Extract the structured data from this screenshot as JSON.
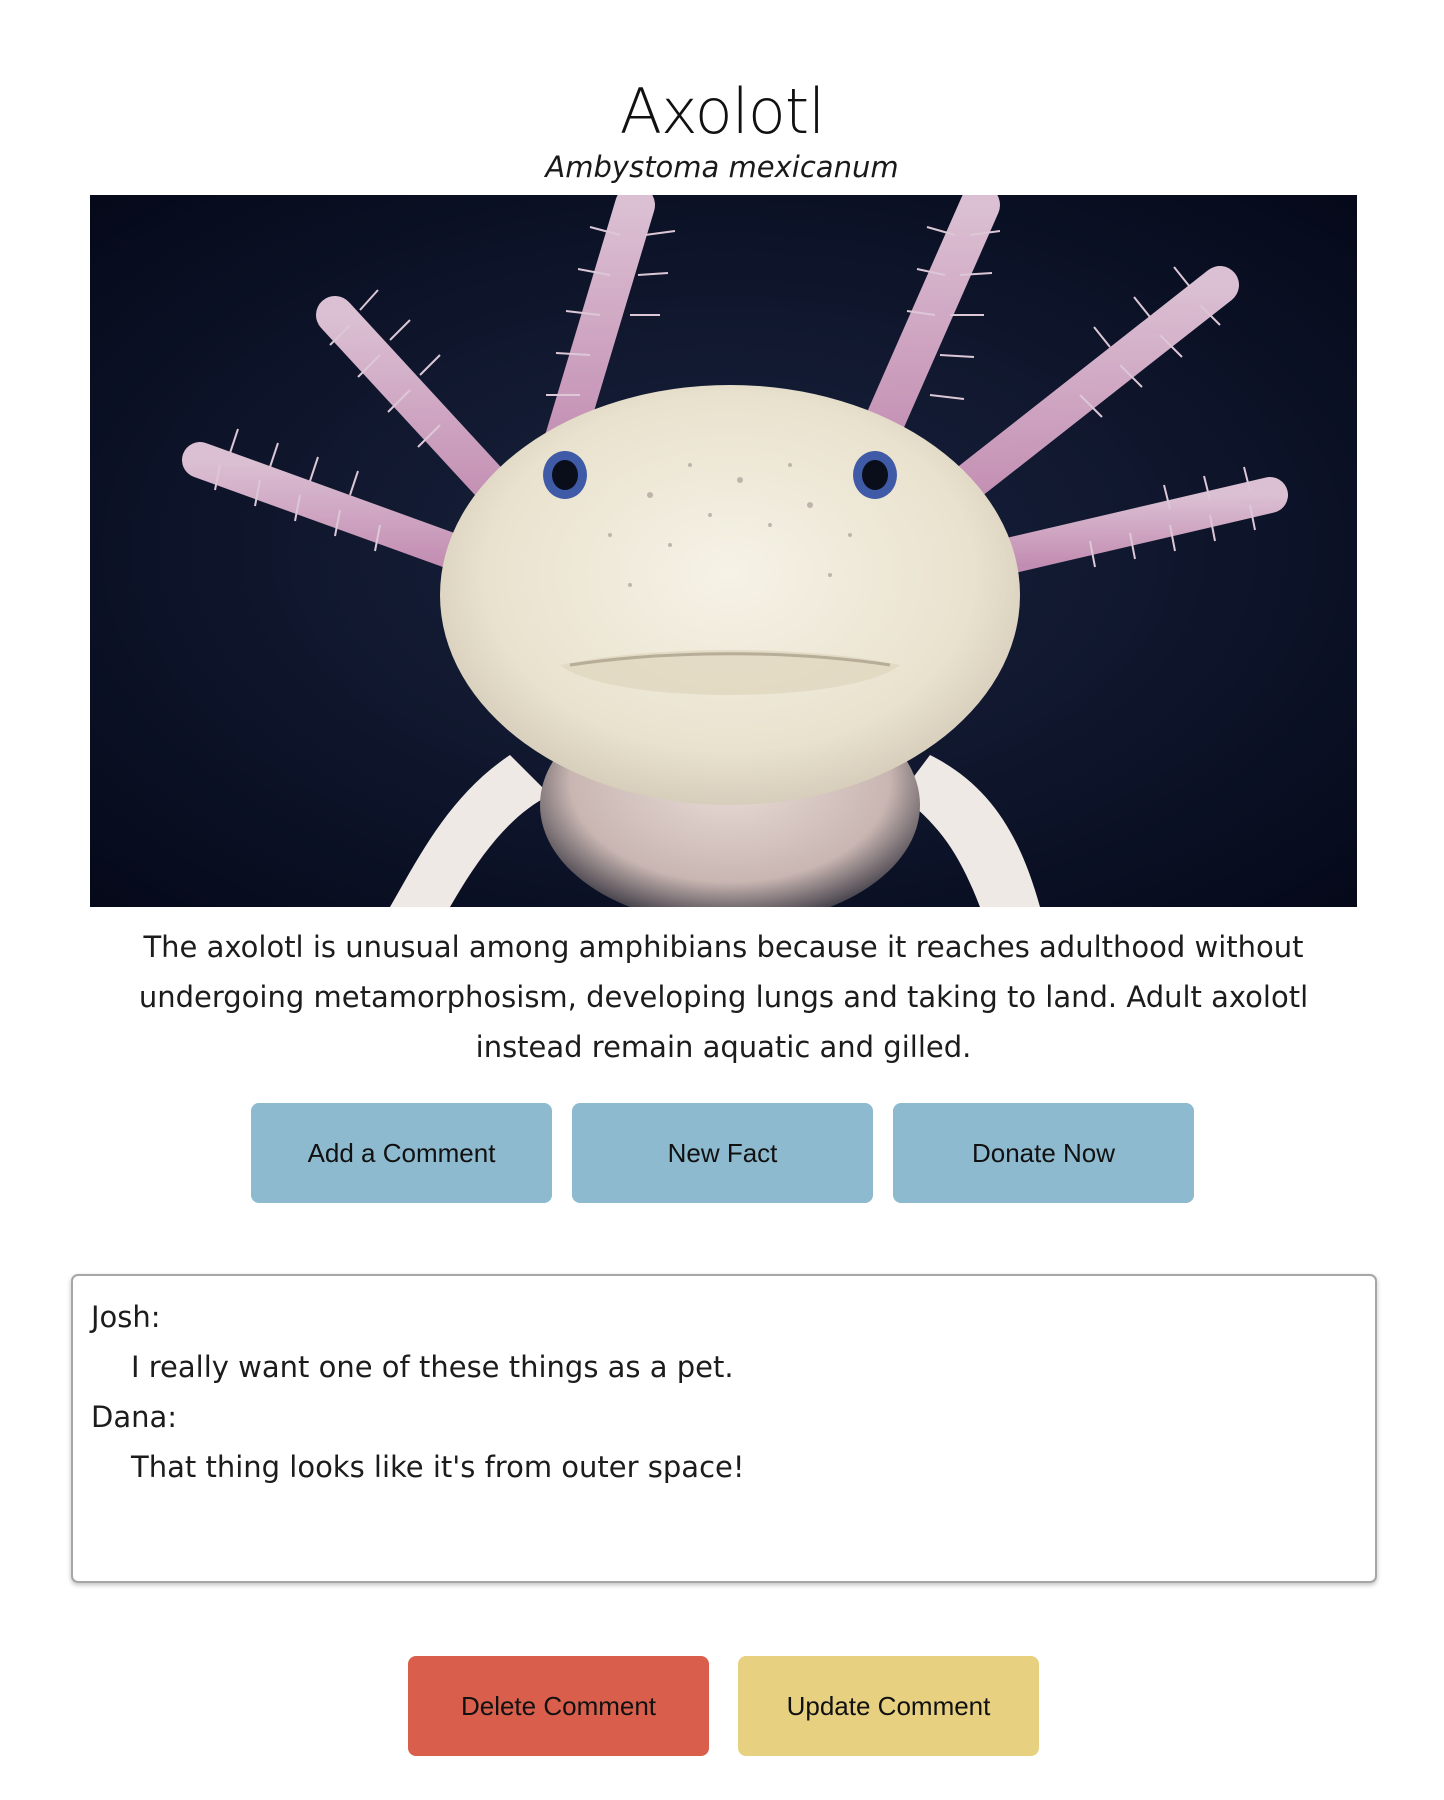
{
  "header": {
    "title": "Axolotl",
    "subtitle": "Ambystoma mexicanum"
  },
  "description": "The axolotl is unusual among amphibians because it reaches adulthood without undergoing metamorphosism, developing lungs and taking to land. Adult axolotl instead remain aquatic and gilled.",
  "actions": {
    "add_comment": "Add a Comment",
    "new_fact": "New Fact",
    "donate_now": "Donate Now"
  },
  "comments": [
    {
      "author": "Josh:",
      "text": "I really want one of these things as a pet."
    },
    {
      "author": "Dana:",
      "text": "That thing looks like it's from outer space!"
    }
  ],
  "comment_actions": {
    "delete": "Delete Comment",
    "update": "Update Comment"
  },
  "colors": {
    "primary_button": "#8dbacf",
    "delete_button": "#d95f4c",
    "update_button": "#e7d181"
  }
}
